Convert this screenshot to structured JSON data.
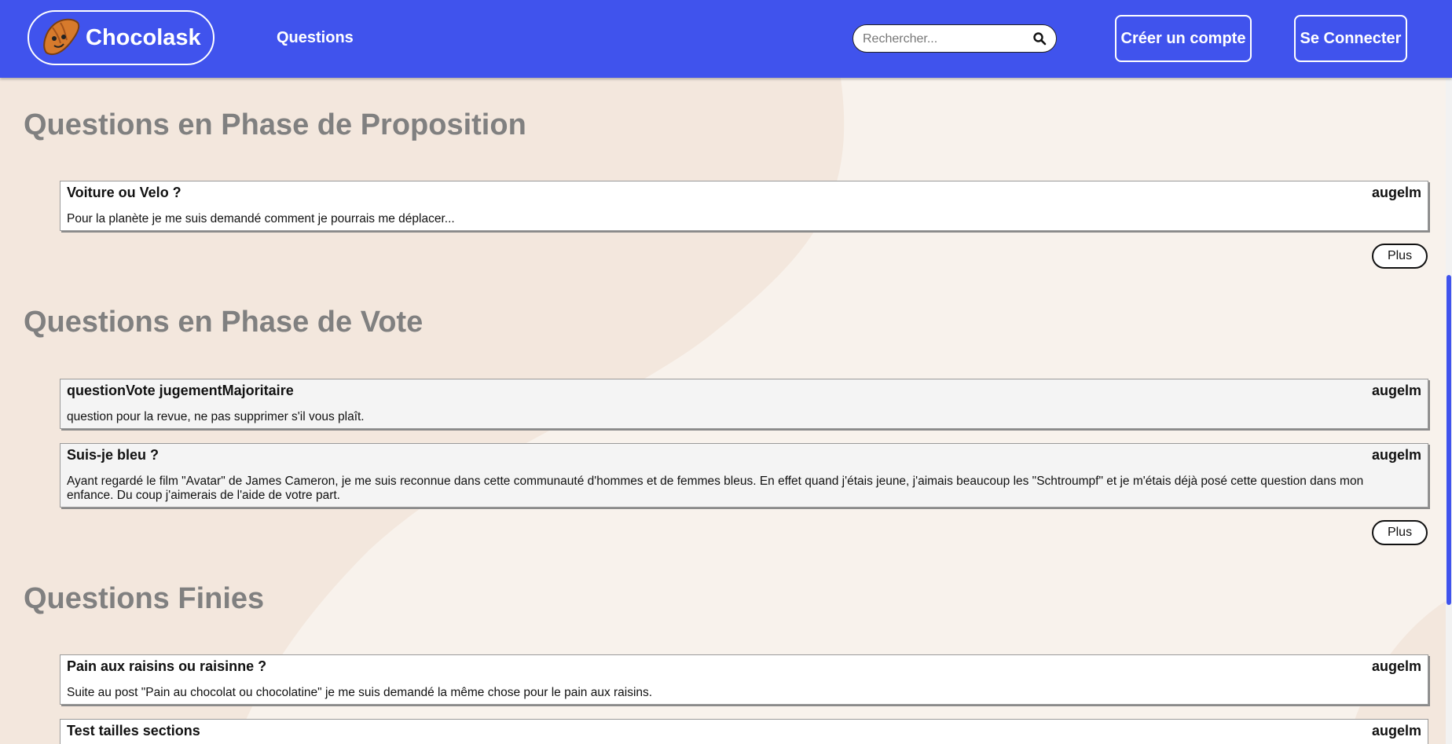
{
  "header": {
    "logo_text": "Chocolask",
    "nav_questions": "Questions",
    "search_placeholder": "Rechercher...",
    "register_label": "Créer un compte",
    "login_label": "Se Connecter"
  },
  "sections": {
    "proposition": {
      "title": "Questions en Phase de Proposition",
      "questions": [
        {
          "title": "Voiture ou Velo ?",
          "author": "augelm",
          "description": "Pour la planète je me suis demandé comment je pourrais me déplacer..."
        }
      ],
      "more_label": "Plus"
    },
    "vote": {
      "title": "Questions en Phase de Vote",
      "questions": [
        {
          "title": "questionVote jugementMajoritaire",
          "author": "augelm",
          "description": "question pour la revue, ne pas supprimer s'il vous plaît."
        },
        {
          "title": "Suis-je bleu ?",
          "author": "augelm",
          "description": "Ayant regardé le film \"Avatar\" de James Cameron, je me suis reconnue dans cette communauté d'hommes et de femmes bleus. En effet quand j'étais jeune, j'aimais beaucoup les \"Schtroumpf\" et je m'étais déjà posé cette question dans mon enfance. Du coup j'aimerais de l'aide de votre part."
        }
      ],
      "more_label": "Plus"
    },
    "finished": {
      "title": "Questions Finies",
      "questions": [
        {
          "title": "Pain aux raisins ou raisinne ?",
          "author": "augelm",
          "description": "Suite au post \"Pain au chocolat ou chocolatine\" je me suis demandé la même chose pour le pain aux raisins."
        },
        {
          "title": "Test tailles sections",
          "author": "augelm",
          "description": ""
        }
      ]
    }
  },
  "colors": {
    "navbar": "#4053ed",
    "page_background": "#f8f2ec",
    "wave_background": "#f3e7dd",
    "section_title": "#808080"
  },
  "icons": {
    "logo": "croissant-mascot-icon",
    "search": "search-icon"
  }
}
